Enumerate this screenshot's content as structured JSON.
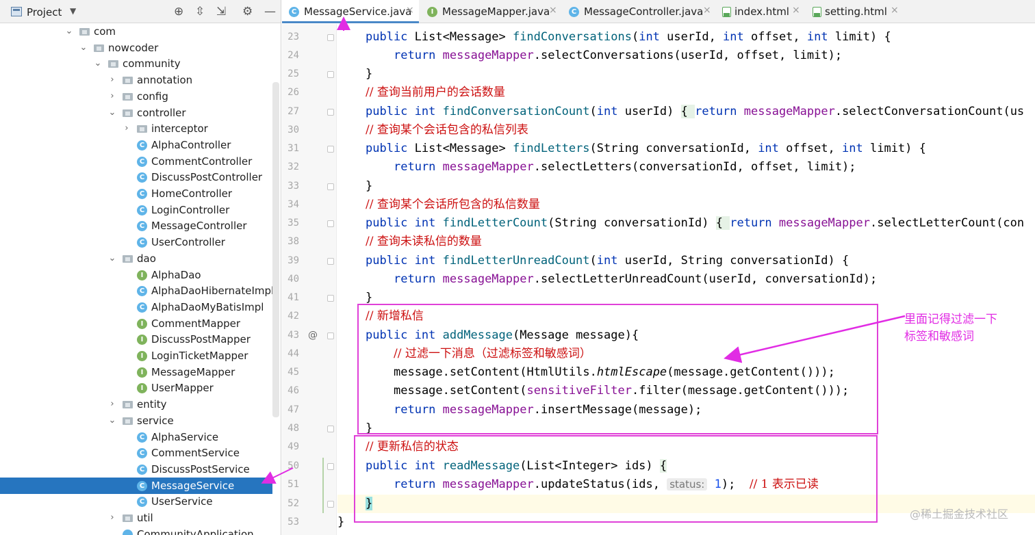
{
  "project_panel": {
    "title": "Project",
    "tree": [
      {
        "label": "com",
        "kind": "folder",
        "expanded": true
      },
      {
        "label": "nowcoder",
        "kind": "folder",
        "expanded": true
      },
      {
        "label": "community",
        "kind": "folder",
        "expanded": true
      },
      {
        "label": "annotation",
        "kind": "folder",
        "expanded": false
      },
      {
        "label": "config",
        "kind": "folder",
        "expanded": false
      },
      {
        "label": "controller",
        "kind": "folder",
        "expanded": true
      },
      {
        "label": "interceptor",
        "kind": "folder",
        "expanded": false
      },
      {
        "label": "AlphaController",
        "kind": "class"
      },
      {
        "label": "CommentController",
        "kind": "class"
      },
      {
        "label": "DiscussPostController",
        "kind": "class"
      },
      {
        "label": "HomeController",
        "kind": "class"
      },
      {
        "label": "LoginController",
        "kind": "class"
      },
      {
        "label": "MessageController",
        "kind": "class"
      },
      {
        "label": "UserController",
        "kind": "class"
      },
      {
        "label": "dao",
        "kind": "folder",
        "expanded": true
      },
      {
        "label": "AlphaDao",
        "kind": "interface"
      },
      {
        "label": "AlphaDaoHibernateImpl",
        "kind": "class"
      },
      {
        "label": "AlphaDaoMyBatisImpl",
        "kind": "class"
      },
      {
        "label": "CommentMapper",
        "kind": "interface"
      },
      {
        "label": "DiscussPostMapper",
        "kind": "interface"
      },
      {
        "label": "LoginTicketMapper",
        "kind": "interface"
      },
      {
        "label": "MessageMapper",
        "kind": "interface"
      },
      {
        "label": "UserMapper",
        "kind": "interface"
      },
      {
        "label": "entity",
        "kind": "folder",
        "expanded": false
      },
      {
        "label": "service",
        "kind": "folder",
        "expanded": true
      },
      {
        "label": "AlphaService",
        "kind": "class"
      },
      {
        "label": "CommentService",
        "kind": "class"
      },
      {
        "label": "DiscussPostService",
        "kind": "class"
      },
      {
        "label": "MessageService",
        "kind": "class",
        "selected": true
      },
      {
        "label": "UserService",
        "kind": "class"
      },
      {
        "label": "util",
        "kind": "folder",
        "expanded": false
      },
      {
        "label": "CommunityApplication",
        "kind": "app"
      }
    ]
  },
  "tabs": [
    {
      "label": "MessageService.java",
      "icon": "class-icon",
      "active": true
    },
    {
      "label": "MessageMapper.java",
      "icon": "interface-icon",
      "active": false
    },
    {
      "label": "MessageController.java",
      "icon": "class-icon",
      "active": false
    },
    {
      "label": "index.html",
      "icon": "html-icon",
      "active": false
    },
    {
      "label": "setting.html",
      "icon": "html-icon",
      "active": false
    }
  ],
  "line_numbers": [
    "23",
    "24",
    "25",
    "26",
    "27",
    "30",
    "31",
    "32",
    "33",
    "34",
    "35",
    "38",
    "39",
    "40",
    "41",
    "42",
    "43",
    "44",
    "45",
    "46",
    "47",
    "48",
    "49",
    "50",
    "51",
    "52",
    "53"
  ],
  "code": {
    "l23": {
      "kw1": "public ",
      "t1": "List<Message> ",
      "m": "findConversations",
      "a1": "(",
      "kw2": "int",
      "a2": " userId, ",
      "kw3": "int",
      "a3": " offset, ",
      "kw4": "int",
      "a4": " limit) {"
    },
    "l24": {
      "kw": "return ",
      "f": "messageMapper",
      "m": ".selectConversations(userId, offset, limit);"
    },
    "l25": "}",
    "l26": "// 查询当前用户的会话数量",
    "l27": {
      "kw1": "public int ",
      "m": "findConversationCount",
      "a1": "(",
      "kw2": "int",
      "a2": " userId) ",
      "fold": "{ ",
      "kw3": "return ",
      "f": "messageMapper",
      "rest": ".selectConversationCount(us"
    },
    "l30": "// 查询某个会话包含的私信列表",
    "l31": {
      "kw1": "public ",
      "t1": "List<Message> ",
      "m": "findLetters",
      "a1": "(String conversationId, ",
      "kw2": "int",
      "a2": " offset, ",
      "kw3": "int",
      "a3": " limit) {"
    },
    "l32": {
      "kw": "return ",
      "f": "messageMapper",
      "m": ".selectLetters(conversationId, offset, limit);"
    },
    "l33": "}",
    "l34": "// 查询某个会话所包含的私信数量",
    "l35": {
      "kw1": "public int ",
      "m": "findLetterCount",
      "a1": "(String conversationId) ",
      "fold": "{ ",
      "kw3": "return ",
      "f": "messageMapper",
      "rest": ".selectLetterCount(con"
    },
    "l38": "// 查询未读私信的数量",
    "l39": {
      "kw1": "public int ",
      "m": "findLetterUnreadCount",
      "a1": "(",
      "kw2": "int",
      "a2": " userId, String conversationId) {"
    },
    "l40": {
      "kw": "return ",
      "f": "messageMapper",
      "m": ".selectLetterUnreadCount(userId, conversationId);"
    },
    "l41": "}",
    "l42": "// 新增私信",
    "l43": {
      "kw1": "public int ",
      "m": "addMessage",
      "a1": "(Message message){"
    },
    "l44": "// 过滤一下消息（过滤标签和敏感词）",
    "l45": {
      "a1": "message.setContent(HtmlUtils.",
      "it": "htmlEscape",
      "a2": "(message.getContent()));"
    },
    "l46": {
      "a1": "message.setContent(",
      "f": "sensitiveFilter",
      "a2": ".filter(message.getContent()));"
    },
    "l47": {
      "kw": "return ",
      "f": "messageMapper",
      "m": ".insertMessage(message);"
    },
    "l48": "}",
    "l49": "// 更新私信的状态",
    "l50": {
      "kw1": "public int ",
      "m": "readMessage",
      "a1": "(List<Integer> ids) ",
      "brace": "{"
    },
    "l51": {
      "kw": "return ",
      "f": "messageMapper",
      "m": ".updateStatus(ids, ",
      "hint": "status:",
      "num": "1",
      "end": ");",
      "cmt": "// 1 表示已读"
    },
    "l52": "}",
    "l53": "}"
  },
  "annotation": {
    "line1": "里面记得过滤一下",
    "line2": "标签和敏感词",
    "color": "#e12ce4"
  },
  "watermark": "@稀土掘金技术社区"
}
